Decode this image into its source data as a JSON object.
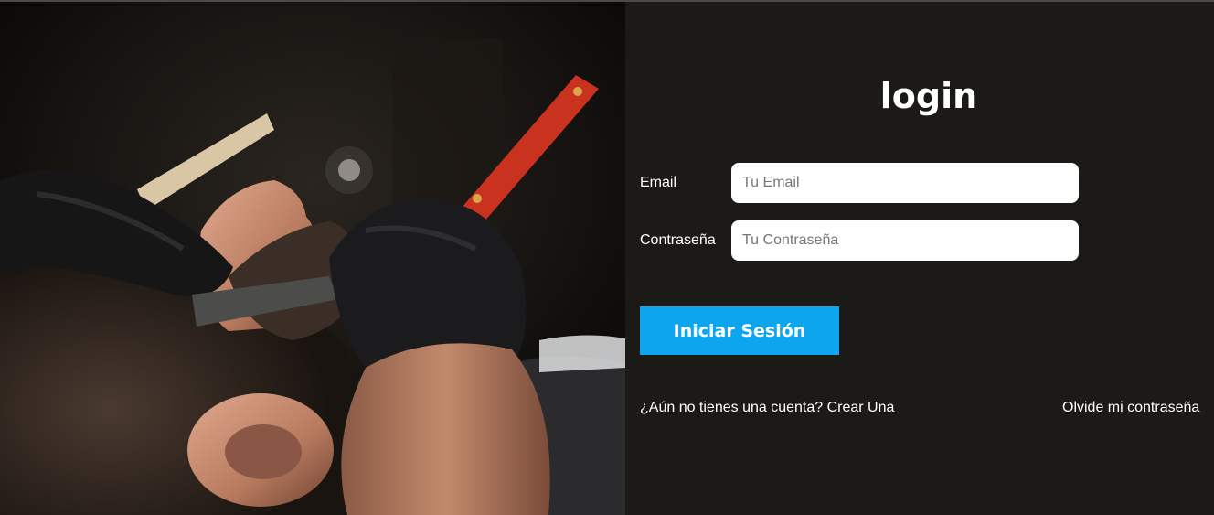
{
  "login": {
    "title": "login",
    "email_label": "Email",
    "email_placeholder": "Tu Email",
    "password_label": "Contraseña",
    "password_placeholder": "Tu Contraseña",
    "submit_label": "Iniciar Sesión",
    "signup_link": "¿Aún no tienes una cuenta? Crear Una",
    "forgot_link": "Olvide mi contraseña"
  },
  "colors": {
    "panel_background": "#1b1a16",
    "button_accent": "#0da5ee",
    "text": "#ffffff"
  }
}
